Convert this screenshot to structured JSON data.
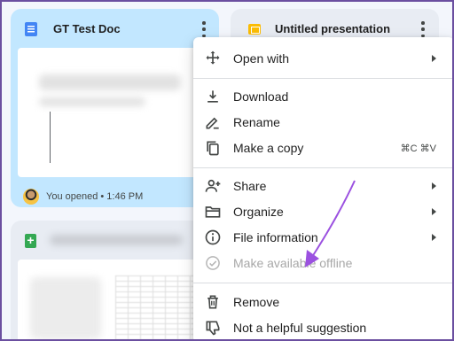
{
  "cards": {
    "doc": {
      "title": "GT Test Doc",
      "opened_text": "You opened • 1:46 PM",
      "icon": "docs-icon"
    },
    "slides": {
      "title": "Untitled presentation",
      "icon": "slides-icon"
    },
    "sheet": {
      "icon": "sheets-icon"
    }
  },
  "menu": {
    "items": [
      {
        "label": "Open with",
        "icon": "move-arrows-icon",
        "submenu": true
      },
      {
        "label": "Download",
        "icon": "download-icon"
      },
      {
        "label": "Rename",
        "icon": "pencil-icon"
      },
      {
        "label": "Make a copy",
        "icon": "copy-icon",
        "shortcut": "⌘C ⌘V"
      },
      {
        "label": "Share",
        "icon": "person-add-icon",
        "submenu": true
      },
      {
        "label": "Organize",
        "icon": "folder-icon",
        "submenu": true
      },
      {
        "label": "File information",
        "icon": "info-icon",
        "submenu": true
      },
      {
        "label": "Make available offline",
        "icon": "offline-check-icon",
        "disabled": true
      },
      {
        "label": "Remove",
        "icon": "trash-icon"
      },
      {
        "label": "Not a helpful suggestion",
        "icon": "thumbs-down-icon"
      }
    ]
  },
  "annotation": {
    "icon": "pointer-arrow-icon",
    "color": "#9b51e0"
  }
}
